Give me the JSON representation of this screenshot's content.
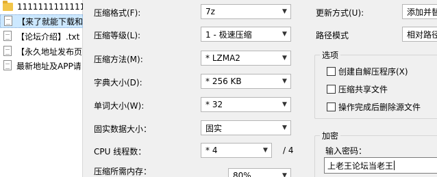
{
  "files": [
    {
      "name": "11111111111111",
      "type": "folder"
    },
    {
      "name": "【来了就能下载和",
      "type": "file"
    },
    {
      "name": "【论坛介绍】.txt",
      "type": "file"
    },
    {
      "name": "【永久地址发布页",
      "type": "file"
    },
    {
      "name": "最新地址及APP请",
      "type": "file"
    }
  ],
  "settings": {
    "format": {
      "label": "压缩格式(F):",
      "value": "7z"
    },
    "level": {
      "label": "压缩等级(L):",
      "value": "1 - 极速压缩"
    },
    "method": {
      "label": "压缩方法(M):",
      "value": "* LZMA2"
    },
    "dict": {
      "label": "字典大小(D):",
      "value": "* 256 KB"
    },
    "word": {
      "label": "单词大小(W):",
      "value": "* 32"
    },
    "solid": {
      "label": "固实数据大小：",
      "value": "固实"
    },
    "cpu": {
      "label": "CPU 线程数：",
      "value": "* 4",
      "suffix": "/ 4"
    },
    "memory": {
      "label": "压缩所需内存：",
      "value": "80%"
    }
  },
  "update": {
    "label": "更新方式(U):",
    "value": "添加并替"
  },
  "path": {
    "label": "路径模式",
    "value": "相对路径"
  },
  "options": {
    "title": "选项",
    "items": [
      {
        "label": "创建自解压程序(X)",
        "checked": false
      },
      {
        "label": "压缩共享文件",
        "checked": false
      },
      {
        "label": "操作完成后删除源文件",
        "checked": false
      }
    ]
  },
  "encrypt": {
    "title": "加密",
    "password_label": "输入密码：",
    "password_value": "上老王论坛当老王"
  }
}
